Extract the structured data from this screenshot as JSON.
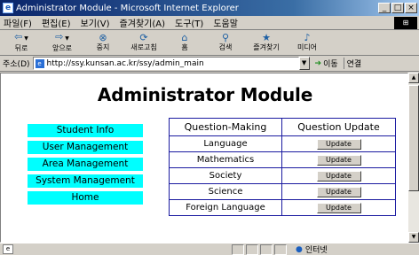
{
  "window": {
    "title": "Administrator Module - Microsoft Internet Explorer",
    "icon": "ie-icon",
    "controls": [
      "_",
      "□",
      "×"
    ]
  },
  "menu": {
    "items": [
      "파일(F)",
      "편집(E)",
      "보기(V)",
      "즐겨찾기(A)",
      "도구(T)",
      "도움말"
    ]
  },
  "toolbar": {
    "back": {
      "label": "뒤로",
      "icon": "back-arrow-icon"
    },
    "forward": {
      "label": "앞으로",
      "icon": "forward-arrow-icon"
    },
    "stop": {
      "label": "중지",
      "icon": "stop-icon"
    },
    "refresh": {
      "label": "새로고침",
      "icon": "refresh-icon"
    },
    "home": {
      "label": "홈",
      "icon": "home-icon"
    },
    "search": {
      "label": "검색",
      "icon": "search-icon"
    },
    "favorites": {
      "label": "즐겨찾기",
      "icon": "favorites-icon"
    },
    "media": {
      "label": "미디어",
      "icon": "media-icon"
    }
  },
  "address": {
    "label": "주소(D)",
    "url": "http://ssy.kunsan.ac.kr/ssy/admin_main",
    "go_label": "이동",
    "links_label": "연결"
  },
  "page": {
    "title": "Administrator Module",
    "nav": [
      "Student Info",
      "User Management",
      "Area Management",
      "System Management",
      "Home"
    ],
    "nav_color": "#00ffff",
    "table": {
      "headers": [
        "Question-Making",
        "Question Update"
      ],
      "rows": [
        {
          "subject": "Language",
          "action": "Update"
        },
        {
          "subject": "Mathematics",
          "action": "Update"
        },
        {
          "subject": "Society",
          "action": "Update"
        },
        {
          "subject": "Science",
          "action": "Update"
        },
        {
          "subject": "Foreign Language",
          "action": "Update"
        }
      ],
      "border_color": "#1a1aa0"
    }
  },
  "status": {
    "zone": "인터넷"
  }
}
